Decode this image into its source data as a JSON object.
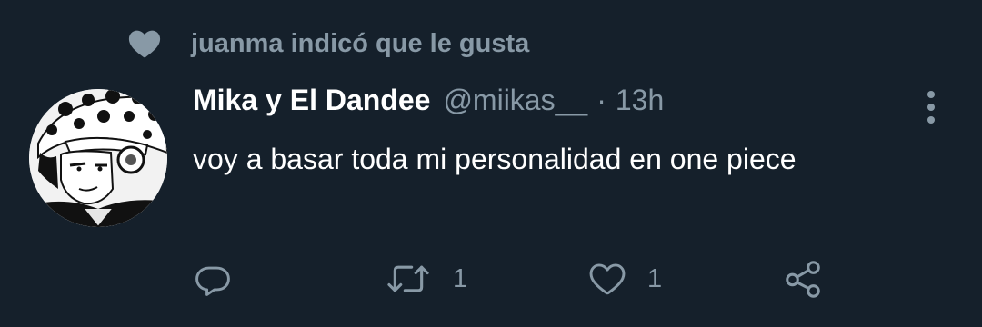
{
  "social_context": {
    "icon": "heart-icon",
    "text": "juanma indicó que le gusta"
  },
  "tweet": {
    "avatar": "avatar",
    "display_name": "Mika y El Dandee",
    "handle": "@miikas__",
    "separator": "·",
    "timestamp": "13h",
    "text": "voy a basar toda mi personalidad en one piece",
    "more_icon": "more-icon"
  },
  "actions": {
    "reply": {
      "icon": "reply-icon",
      "count": ""
    },
    "retweet": {
      "icon": "retweet-icon",
      "count": "1"
    },
    "like": {
      "icon": "like-icon",
      "count": "1"
    },
    "share": {
      "icon": "share-icon",
      "count": ""
    }
  },
  "colors": {
    "background": "#15202b",
    "primary_text": "#ffffff",
    "secondary_text": "#8899a6"
  }
}
